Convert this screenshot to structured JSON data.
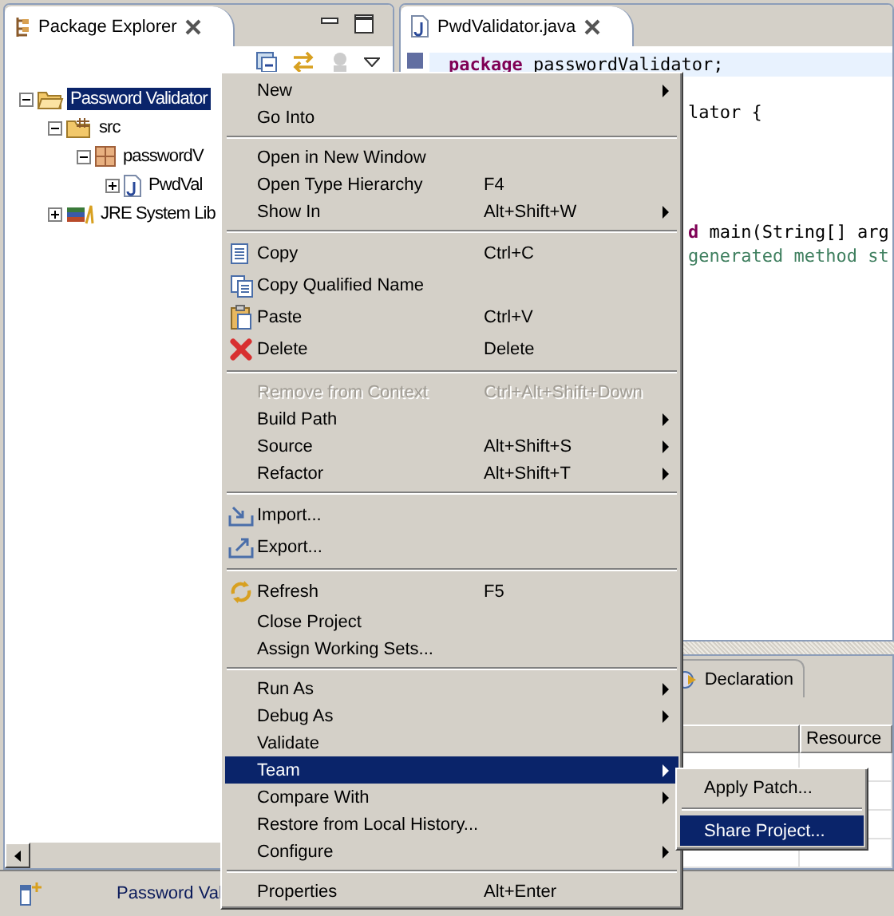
{
  "package_explorer": {
    "title": "Package Explorer",
    "tree": [
      {
        "label": "Password Validator",
        "selected": true,
        "expanded": true,
        "kind": "project",
        "children": [
          {
            "label": "src",
            "selected": false,
            "expanded": true,
            "kind": "folder",
            "children": [
              {
                "label": "passwordV",
                "selected": false,
                "expanded": true,
                "kind": "package",
                "children": [
                  {
                    "label": "PwdVal",
                    "selected": false,
                    "expanded": false,
                    "kind": "java"
                  }
                ]
              }
            ]
          },
          {
            "label": "JRE System Lib",
            "selected": false,
            "expanded": false,
            "kind": "library"
          }
        ]
      }
    ]
  },
  "editor": {
    "tab": "PwdValidator.java",
    "lines": [
      {
        "kind": "full",
        "current": true,
        "parts": [
          {
            "kind": "keyword",
            "text": "package"
          },
          {
            "kind": "plain",
            "text": " passwordValidator;"
          }
        ]
      },
      {
        "kind": "blank",
        "current": false
      },
      {
        "kind": "behind_menu",
        "current": false,
        "parts": [
          {
            "kind": "plain",
            "text": "lator {"
          }
        ]
      },
      {
        "kind": "blank",
        "current": false
      },
      {
        "kind": "blank",
        "current": false
      },
      {
        "kind": "blank",
        "current": false
      },
      {
        "kind": "blank",
        "current": false
      },
      {
        "kind": "behind_menu",
        "current": false,
        "parts": [
          {
            "kind": "keyword",
            "text": "d"
          },
          {
            "kind": "plain",
            "text": " main(String[] arg"
          }
        ]
      },
      {
        "kind": "behind_menu",
        "current": false,
        "parts": [
          {
            "kind": "comment",
            "text": "generated method st"
          }
        ]
      }
    ]
  },
  "bottom_panel": {
    "tabs": [
      {
        "label": "Declaration"
      }
    ],
    "columns": [
      "Resource"
    ]
  },
  "status_bar": {
    "text": "Password Val"
  },
  "context_menu": {
    "items": [
      {
        "kind": "plain",
        "label": "New",
        "submenu": true
      },
      {
        "kind": "plain",
        "label": "Go Into"
      },
      {
        "kind": "separator"
      },
      {
        "kind": "plain",
        "label": "Open in New Window"
      },
      {
        "kind": "plain",
        "label": "Open Type Hierarchy",
        "shortcut": "F4"
      },
      {
        "kind": "plain",
        "label": "Show In",
        "shortcut": "Alt+Shift+W",
        "submenu": true
      },
      {
        "kind": "separator"
      },
      {
        "kind": "copy",
        "label": "Copy",
        "shortcut": "Ctrl+C"
      },
      {
        "kind": "copy_name",
        "label": "Copy Qualified Name"
      },
      {
        "kind": "paste",
        "label": "Paste",
        "shortcut": "Ctrl+V"
      },
      {
        "kind": "delete",
        "label": "Delete",
        "shortcut": "Delete"
      },
      {
        "kind": "separator"
      },
      {
        "kind": "plain",
        "label": "Remove from Context",
        "shortcut": "Ctrl+Alt+Shift+Down",
        "disabled": true
      },
      {
        "kind": "plain",
        "label": "Build Path",
        "submenu": true
      },
      {
        "kind": "plain",
        "label": "Source",
        "shortcut": "Alt+Shift+S",
        "submenu": true
      },
      {
        "kind": "plain",
        "label": "Refactor",
        "shortcut": "Alt+Shift+T",
        "submenu": true
      },
      {
        "kind": "separator"
      },
      {
        "kind": "import",
        "label": "Import..."
      },
      {
        "kind": "export",
        "label": "Export..."
      },
      {
        "kind": "separator"
      },
      {
        "kind": "refresh",
        "label": "Refresh",
        "shortcut": "F5"
      },
      {
        "kind": "plain",
        "label": "Close Project"
      },
      {
        "kind": "plain",
        "label": "Assign Working Sets..."
      },
      {
        "kind": "separator"
      },
      {
        "kind": "plain",
        "label": "Run As",
        "submenu": true
      },
      {
        "kind": "plain",
        "label": "Debug As",
        "submenu": true
      },
      {
        "kind": "plain",
        "label": "Validate"
      },
      {
        "kind": "plain",
        "label": "Team",
        "submenu": true,
        "selected": true
      },
      {
        "kind": "plain",
        "label": "Compare With",
        "submenu": true
      },
      {
        "kind": "plain",
        "label": "Restore from Local History..."
      },
      {
        "kind": "plain",
        "label": "Configure",
        "submenu": true
      },
      {
        "kind": "separator"
      },
      {
        "kind": "plain",
        "label": "Properties",
        "shortcut": "Alt+Enter"
      }
    ]
  },
  "team_submenu": {
    "items": [
      {
        "kind": "plain",
        "label": "Apply Patch...",
        "selected": false
      },
      {
        "kind": "separator"
      },
      {
        "kind": "plain",
        "label": "Share Project...",
        "selected": true
      }
    ]
  }
}
